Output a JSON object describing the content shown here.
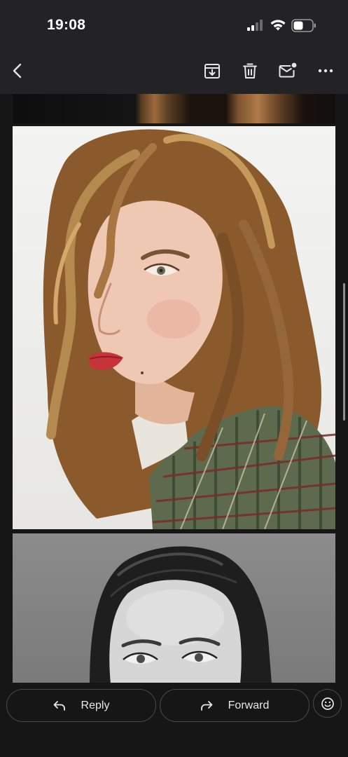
{
  "status_bar": {
    "time": "19:08",
    "icons": [
      "signal-icon",
      "wifi-icon",
      "battery-icon"
    ]
  },
  "app_bar": {
    "icons": [
      "back-icon",
      "archive-icon",
      "delete-icon",
      "mark-unread-icon",
      "more-icon"
    ]
  },
  "message": {
    "images": [
      {
        "name": "photo-previous",
        "tone": "color"
      },
      {
        "name": "photo-color-portrait",
        "tone": "color"
      },
      {
        "name": "photo-bw-portrait",
        "tone": "grayscale"
      }
    ]
  },
  "actions": {
    "reply_label": "Reply",
    "forward_label": "Forward",
    "reply_icon": "reply-icon",
    "forward_icon": "forward-icon",
    "emoji_icon": "emoji-icon"
  },
  "colors": {
    "bar_background": "#232325",
    "screen_background": "#161617",
    "text": "#e8e8ea",
    "outline": "#4a4a4d"
  }
}
